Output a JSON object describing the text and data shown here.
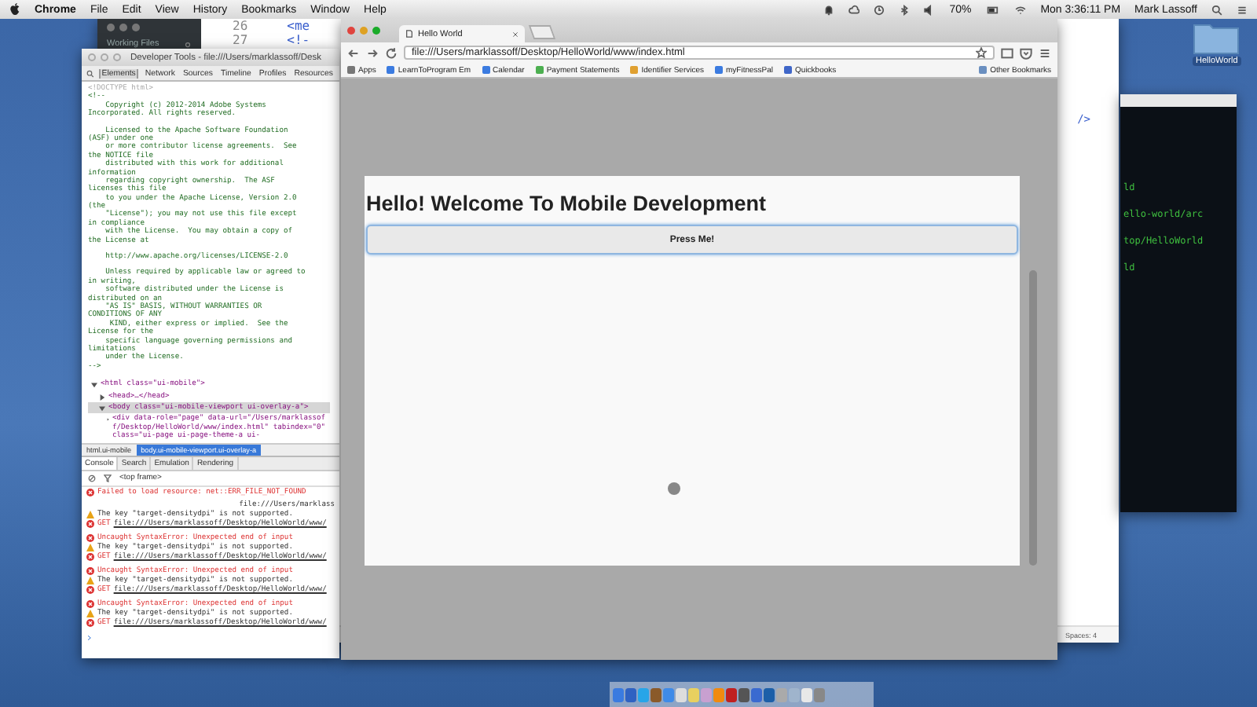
{
  "menu_bar": {
    "app": "Chrome",
    "menus": [
      "File",
      "Edit",
      "View",
      "History",
      "Bookmarks",
      "Window",
      "Help"
    ],
    "battery": "70%",
    "clock": "Mon 3:36:11 PM",
    "user": "Mark Lassoff"
  },
  "desktop": {
    "folder_label": "HelloWorld"
  },
  "editor": {
    "sidebar_title": "Working Files",
    "lines": [
      {
        "number": "26",
        "code": "<me"
      },
      {
        "number": "27",
        "code": "<!-"
      }
    ],
    "visible_tail": "/>",
    "status": "Spaces: 4"
  },
  "terminal": {
    "lines": [
      "ld",
      "ello-world/arc",
      "top/HelloWorld",
      "ld"
    ]
  },
  "devtools": {
    "title": "Developer Tools - file:///Users/marklassoff/Desk",
    "tabs": [
      {
        "label": "Elements",
        "selected": true
      },
      {
        "label": "Network",
        "selected": false
      },
      {
        "label": "Sources",
        "selected": false
      },
      {
        "label": "Timeline",
        "selected": false
      },
      {
        "label": "Profiles",
        "selected": false
      },
      {
        "label": "Resources",
        "selected": false
      }
    ],
    "source_blocks": [
      [
        "<!DOCTYPE html>",
        "<!--",
        "    Copyright (c) 2012-2014 Adobe Systems",
        "Incorporated. All rights reserved."
      ],
      [
        "    Licensed to the Apache Software Foundation",
        "(ASF) under one",
        "    or more contributor license agreements.  See",
        "the NOTICE file",
        "    distributed with this work for additional",
        "information",
        "    regarding copyright ownership.  The ASF",
        "licenses this file",
        "    to you under the Apache License, Version 2.0",
        "(the",
        "    \"License\"); you may not use this file except",
        "in compliance",
        "    with the License.  You may obtain a copy of",
        "the License at"
      ],
      [
        "    http://www.apache.org/licenses/LICENSE-2.0"
      ],
      [
        "    Unless required by applicable law or agreed to",
        "in writing,",
        "    software distributed under the License is",
        "distributed on an",
        "    \"AS IS\" BASIS, WITHOUT WARRANTIES OR",
        "CONDITIONS OF ANY",
        "     KIND, either express or implied.  See the",
        "License for the",
        "    specific language governing permissions and",
        "limitations",
        "    under the License.",
        "-->"
      ]
    ],
    "tree": [
      {
        "text": "<html class=\"ui-mobile\">",
        "expanded": true,
        "selected": false,
        "children": [
          {
            "text": "<head>…</head>",
            "expanded": false,
            "selected": false
          },
          {
            "text": "<body class=\"ui-mobile-viewport ui-overlay-a\">",
            "expanded": true,
            "selected": true,
            "children": [
              {
                "text": "<div data-role=\"page\" data-url=\"/Users/marklassoff/Desktop/HelloWorld/www/index.html\" tabindex=\"0\" class=\"ui-page ui-page-theme-a ui-",
                "expanded": false,
                "selected": false
              }
            ]
          }
        ]
      }
    ],
    "breadcrumbs": [
      {
        "label": "html.ui-mobile",
        "selected": false
      },
      {
        "label": "body.ui-mobile-viewport.ui-overlay-a",
        "selected": true
      }
    ],
    "drawer_tabs": [
      {
        "label": "Console",
        "selected": true
      },
      {
        "label": "Search",
        "selected": false
      },
      {
        "label": "Emulation",
        "selected": false
      },
      {
        "label": "Rendering",
        "selected": false
      }
    ],
    "frame_selector": "<top frame>",
    "console_groups": [
      [
        {
          "kind": "error",
          "text": "Failed to load resource: net::ERR_FILE_NOT_FOUND",
          "source": "file:///Users/marklass"
        },
        {
          "kind": "warning",
          "text": "The key \"target-densitydpi\" is not supported."
        },
        {
          "kind": "error",
          "text": "GET",
          "link": "file:///Users/marklassoff/Desktop/HelloWorld/www/"
        }
      ],
      [
        {
          "kind": "error",
          "text": "Uncaught SyntaxError: Unexpected end of input"
        },
        {
          "kind": "warning",
          "text": "The key \"target-densitydpi\" is not supported."
        },
        {
          "kind": "error",
          "text": "GET",
          "link": "file:///Users/marklassoff/Desktop/HelloWorld/www/"
        }
      ],
      [
        {
          "kind": "error",
          "text": "Uncaught SyntaxError: Unexpected end of input"
        },
        {
          "kind": "warning",
          "text": "The key \"target-densitydpi\" is not supported."
        },
        {
          "kind": "error",
          "text": "GET",
          "link": "file:///Users/marklassoff/Desktop/HelloWorld/www/"
        }
      ],
      [
        {
          "kind": "error",
          "text": "Uncaught SyntaxError: Unexpected end of input"
        },
        {
          "kind": "warning",
          "text": "The key \"target-densitydpi\" is not supported."
        },
        {
          "kind": "error",
          "text": "GET",
          "link": "file:///Users/marklassoff/Desktop/HelloWorld/www/"
        }
      ]
    ]
  },
  "browser": {
    "tabs": [
      {
        "title": "Hello World",
        "selected": true
      }
    ],
    "url": "file:///Users/marklassoff/Desktop/HelloWorld/www/index.html",
    "bookmarks": [
      "Apps",
      "LearnToProgram Em",
      "Calendar",
      "Payment Statements",
      "Identifier Services",
      "myFitnessPal",
      "Quickbooks"
    ],
    "other_bookmarks": "Other Bookmarks",
    "page": {
      "heading": "Hello! Welcome To Mobile Development",
      "button": "Press Me!"
    }
  }
}
